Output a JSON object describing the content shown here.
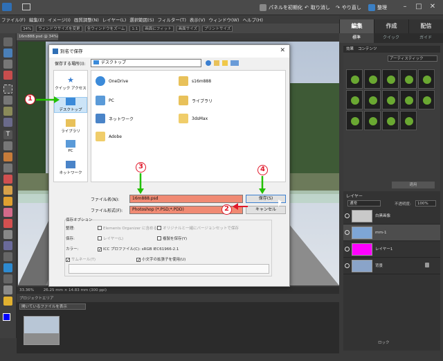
{
  "app": {
    "top_buttons": {
      "panel": "パネルを初期化",
      "undo": "取り消し",
      "redo": "やり直し",
      "organizer": "整理"
    },
    "menu": [
      "ファイル(F)",
      "編集(E)",
      "イメージ(I)",
      "画質調整(N)",
      "レイヤー(L)",
      "選択範囲(S)",
      "フィルター(T)",
      "表示(V)",
      "ウィンドウ(W)",
      "ヘルプ(H)"
    ],
    "mode_tabs": [
      "編集",
      "作成",
      "配信"
    ],
    "sub_tabs": [
      "標準",
      "クイック",
      "ガイド"
    ],
    "options": {
      "zoom": "34%",
      "check1": "ウィンドウサイズを変更",
      "check2": "全ウィンドウをズーム",
      "pct": "1:1",
      "b1": "画面にフィット",
      "b2": "画面サイズ",
      "b3": "プリントサイズ"
    },
    "doc_tab": "16m888.psd @ 34%(RGB/8)",
    "status": "33.36%",
    "status_info": "26.25 mm × 14.83 mm (300 ppi)",
    "project_bin_label": "プロジェクトエリア",
    "project_bin_select": "開いているファイルを表示"
  },
  "panels": {
    "effects_tabs": [
      "効果",
      "コンテンツ"
    ],
    "effects_select": "アーティスティック",
    "apply_button": "適用",
    "layers_title": "レイヤー",
    "blend_mode": "通常",
    "opacity_label": "不透明度:",
    "opacity_value": "100%",
    "layers": [
      {
        "name": "白黒画像"
      },
      {
        "name": "ｍｍ-1"
      },
      {
        "name": "レイヤー1"
      },
      {
        "name": "背景"
      }
    ],
    "layer_colors": [
      "#ffffff",
      "#7ea6d6",
      "#ff00ff",
      "#8aa4c9"
    ],
    "lock_label": "ロック"
  },
  "dialog": {
    "title": "別名で保存",
    "save_in_label": "保存する場所(I):",
    "save_in_value": "デスクトップ",
    "places": [
      "クイック アクセス",
      "デスクトップ",
      "ライブラリ",
      "PC",
      "ネットワーク"
    ],
    "files": [
      {
        "name": "OneDrive",
        "icon": "cloud-icon"
      },
      {
        "name": "s16m888",
        "icon": "user-folder-icon"
      },
      {
        "name": "PC",
        "icon": "pc-icon"
      },
      {
        "name": "ライブラリ",
        "icon": "library-icon"
      },
      {
        "name": "ネットワーク",
        "icon": "network-icon"
      },
      {
        "name": "3dsMax",
        "icon": "folder-icon"
      },
      {
        "name": "Adobe",
        "icon": "folder-icon"
      }
    ],
    "filename_label": "ファイル名(N):",
    "filename_value": "16m888.psd",
    "format_label": "ファイル形式(F):",
    "format_value": "Photoshop (*.PSD;*.PDD)",
    "save_button": "保存(S)",
    "cancel_button": "キャンセル",
    "save_options_title": "保存オプション",
    "organize_label": "整理:",
    "organize_opt1": "Elements Organizer に含める",
    "organize_opt2": "オリジナルと一緒にバージョンセットで保存",
    "save_label": "保存:",
    "save_opt1": "レイヤー(L)",
    "save_opt2": "複製を保存(Y)",
    "color_label": "カラー:",
    "color_opt": "ICC プロファイル(C): sRGB IEC61966-2.1",
    "thumb_opt": "サムネール(T)",
    "lowercase_opt": "小文字の拡張子を使用(U)"
  },
  "annotations": [
    "1",
    "2",
    "3",
    "4"
  ],
  "colors": {
    "highlight": "#f08a73",
    "annotation_red": "#e0182a",
    "annotation_green": "#22c000"
  }
}
